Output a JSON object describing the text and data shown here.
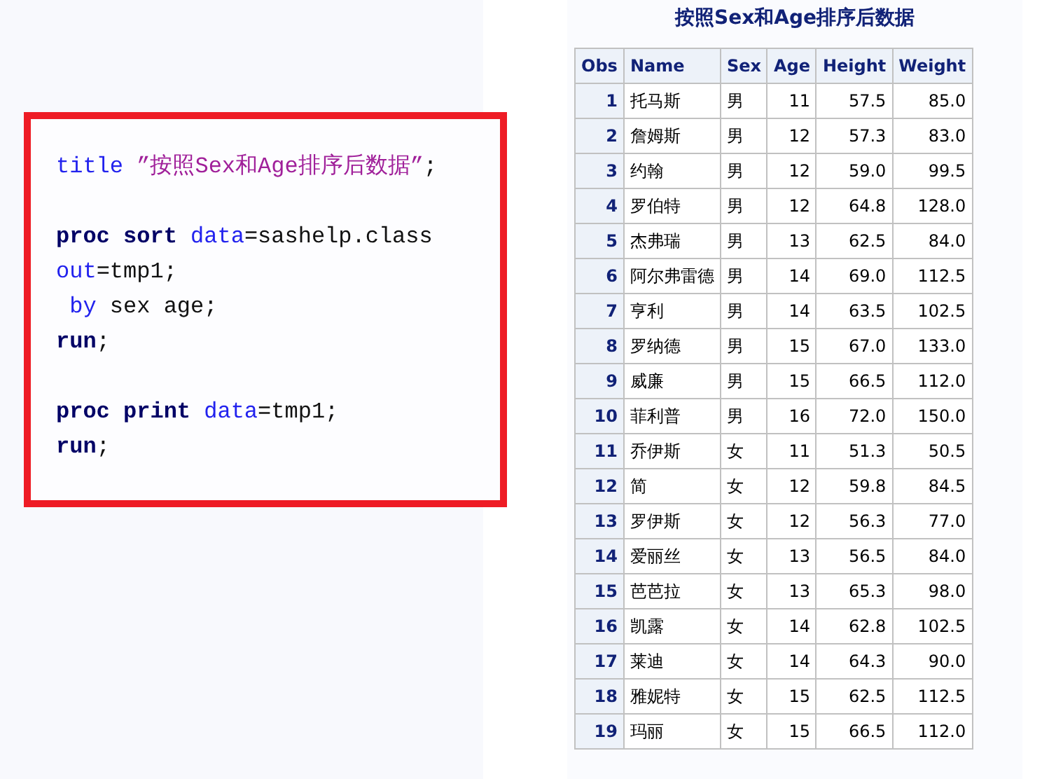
{
  "code": {
    "blocks": [
      {
        "lines": [
          {
            "tokens": [
              {
                "kind": "option",
                "text": "title"
              },
              {
                "kind": "string",
                "text": " ”按照Sex和Age排序后数据”"
              },
              {
                "kind": "text",
                "text": ";"
              }
            ]
          }
        ]
      },
      {
        "lines": [
          {
            "tokens": [
              {
                "kind": "proc",
                "text": "proc sort"
              },
              {
                "kind": "option",
                "text": " data"
              },
              {
                "kind": "text",
                "text": "=sashelp.class"
              }
            ]
          },
          {
            "tokens": [
              {
                "kind": "option",
                "text": "out"
              },
              {
                "kind": "text",
                "text": "=tmp1;"
              }
            ]
          },
          {
            "tokens": [
              {
                "kind": "option",
                "text": " by"
              },
              {
                "kind": "text",
                "text": " sex age;"
              }
            ]
          },
          {
            "tokens": [
              {
                "kind": "proc",
                "text": "run"
              },
              {
                "kind": "text",
                "text": ";"
              }
            ]
          }
        ]
      },
      {
        "lines": [
          {
            "tokens": [
              {
                "kind": "proc",
                "text": "proc print"
              },
              {
                "kind": "option",
                "text": " data"
              },
              {
                "kind": "text",
                "text": "=tmp1;"
              }
            ]
          },
          {
            "tokens": [
              {
                "kind": "proc",
                "text": "run"
              },
              {
                "kind": "text",
                "text": ";"
              }
            ]
          }
        ]
      }
    ]
  },
  "output": {
    "title": "按照Sex和Age排序后数据",
    "columns": [
      "Obs",
      "Name",
      "Sex",
      "Age",
      "Height",
      "Weight"
    ],
    "rows": [
      [
        "1",
        "托马斯",
        "男",
        "11",
        "57.5",
        "85.0"
      ],
      [
        "2",
        "詹姆斯",
        "男",
        "12",
        "57.3",
        "83.0"
      ],
      [
        "3",
        "约翰",
        "男",
        "12",
        "59.0",
        "99.5"
      ],
      [
        "4",
        "罗伯特",
        "男",
        "12",
        "64.8",
        "128.0"
      ],
      [
        "5",
        "杰弗瑞",
        "男",
        "13",
        "62.5",
        "84.0"
      ],
      [
        "6",
        "阿尔弗雷德",
        "男",
        "14",
        "69.0",
        "112.5"
      ],
      [
        "7",
        "亨利",
        "男",
        "14",
        "63.5",
        "102.5"
      ],
      [
        "8",
        "罗纳德",
        "男",
        "15",
        "67.0",
        "133.0"
      ],
      [
        "9",
        "威廉",
        "男",
        "15",
        "66.5",
        "112.0"
      ],
      [
        "10",
        "菲利普",
        "男",
        "16",
        "72.0",
        "150.0"
      ],
      [
        "11",
        "乔伊斯",
        "女",
        "11",
        "51.3",
        "50.5"
      ],
      [
        "12",
        "简",
        "女",
        "12",
        "59.8",
        "84.5"
      ],
      [
        "13",
        "罗伊斯",
        "女",
        "12",
        "56.3",
        "77.0"
      ],
      [
        "14",
        "爱丽丝",
        "女",
        "13",
        "56.5",
        "84.0"
      ],
      [
        "15",
        "芭芭拉",
        "女",
        "13",
        "65.3",
        "98.0"
      ],
      [
        "16",
        "凯露",
        "女",
        "14",
        "62.8",
        "102.5"
      ],
      [
        "17",
        "莱迪",
        "女",
        "14",
        "64.3",
        "90.0"
      ],
      [
        "18",
        "雅妮特",
        "女",
        "15",
        "62.5",
        "112.5"
      ],
      [
        "19",
        "玛丽",
        "女",
        "15",
        "66.5",
        "112.0"
      ]
    ]
  }
}
